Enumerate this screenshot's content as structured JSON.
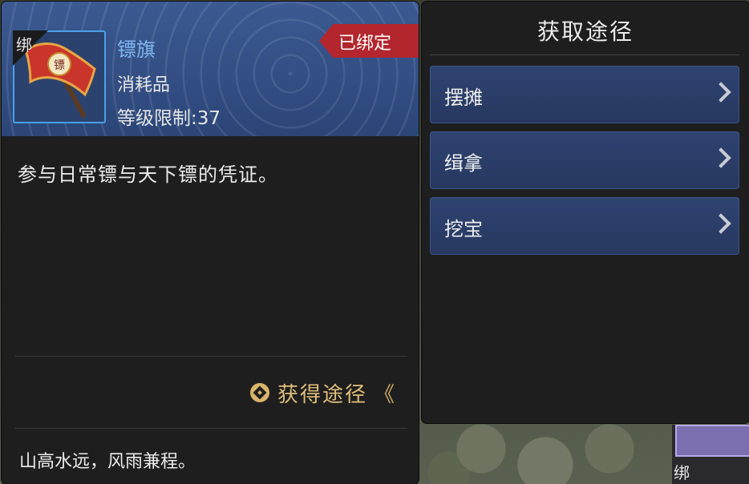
{
  "item": {
    "bind_mark": "绑",
    "name": "镖旗",
    "type": "消耗品",
    "level_req": "等级限制:37",
    "bound_tag": "已绑定",
    "description": "参与日常镖与天下镖的凭证。",
    "obtain_link": "获得途径",
    "obtain_chevron": "《",
    "flavor": "山高水远，风雨兼程。",
    "icon": "escort-flag-icon"
  },
  "acquire": {
    "title": "获取途径",
    "options": [
      {
        "label": "摆摊"
      },
      {
        "label": "缉拿"
      },
      {
        "label": "挖宝"
      }
    ]
  },
  "slot": {
    "bind_mark": "绑"
  },
  "colors": {
    "header_blue": "#3c5a92",
    "name_blue": "#7fb6ef",
    "bound_red": "#b3262d",
    "gold": "#e0bf79",
    "row_blue": "#2f4372"
  }
}
